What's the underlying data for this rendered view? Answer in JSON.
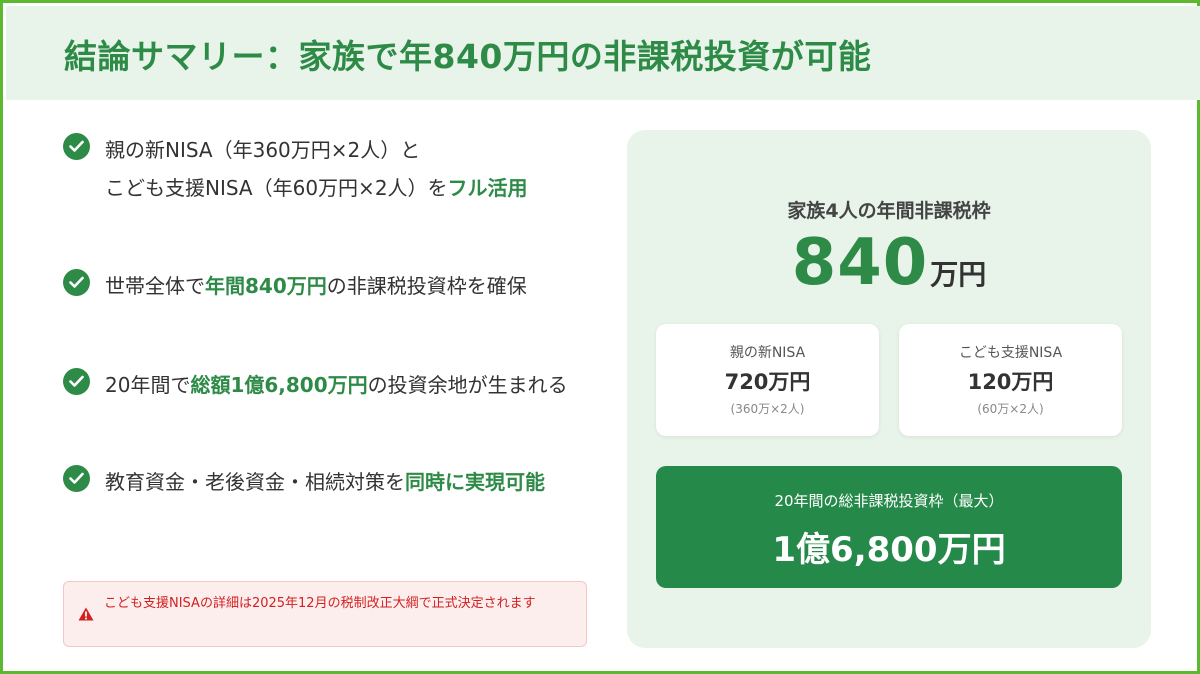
{
  "header": {
    "title": "結論サマリー：家族で年840万円の非課税投資が可能"
  },
  "bullets": [
    {
      "parts": [
        "親の新NISA（年360万円×2人）と\nこども支援NISA（年60万円×2人）を",
        "フル活用",
        ""
      ]
    },
    {
      "parts": [
        "世帯全体で",
        "年間840万円",
        "の非課税投資枠を確保"
      ]
    },
    {
      "parts": [
        "20年間で",
        "総額1億6,800万円",
        "の投資余地が生まれる"
      ]
    },
    {
      "parts": [
        "教育資金・老後資金・相続対策を",
        "同時に実現可能",
        ""
      ]
    }
  ],
  "warning": {
    "icon": "warning-triangle-icon",
    "text": "こども支援NISAの詳細は2025年12月の税制改正大綱で正式決定されます"
  },
  "panel": {
    "label": "家族4人の年間非課税枠",
    "amount": "840",
    "unit": "万円",
    "cards": [
      {
        "title": "親の新NISA",
        "value": "720万円",
        "sub": "(360万×2人)"
      },
      {
        "title": "こども支援NISA",
        "value": "120万円",
        "sub": "(60万×2人)"
      }
    ],
    "total": {
      "label": "20年間の総非課税投資枠（最大）",
      "value": "1億6,800万円"
    }
  },
  "colors": {
    "accent": "#2e8b47",
    "border": "#5cb82e",
    "header_bg": "#e8f4e9",
    "total_bg": "#25894a",
    "warning": "#d32020"
  }
}
